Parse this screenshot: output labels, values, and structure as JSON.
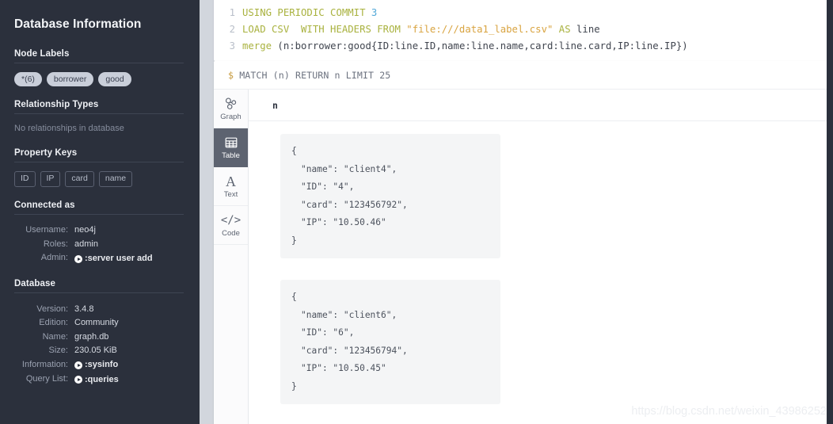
{
  "sidebar": {
    "title": "Database Information",
    "sections": {
      "node_labels": {
        "heading": "Node Labels",
        "pills": [
          "*(6)",
          "borrower",
          "good"
        ]
      },
      "relationship_types": {
        "heading": "Relationship Types",
        "empty_text": "No relationships in database"
      },
      "property_keys": {
        "heading": "Property Keys",
        "chips": [
          "ID",
          "IP",
          "card",
          "name"
        ]
      },
      "connected_as": {
        "heading": "Connected as",
        "rows": [
          {
            "key": "Username:",
            "value": "neo4j",
            "command": false
          },
          {
            "key": "Roles:",
            "value": "admin",
            "command": false
          },
          {
            "key": "Admin:",
            "value": ":server user add",
            "command": true
          }
        ]
      },
      "database": {
        "heading": "Database",
        "rows": [
          {
            "key": "Version:",
            "value": "3.4.8",
            "command": false
          },
          {
            "key": "Edition:",
            "value": "Community",
            "command": false
          },
          {
            "key": "Name:",
            "value": "graph.db",
            "command": false
          },
          {
            "key": "Size:",
            "value": "230.05 KiB",
            "command": false
          },
          {
            "key": "Information:",
            "value": ":sysinfo",
            "command": true
          },
          {
            "key": "Query List:",
            "value": ":queries",
            "command": true
          }
        ]
      }
    }
  },
  "editor": {
    "lines": [
      {
        "number": "1",
        "tokens": [
          {
            "t": "USING PERIODIC COMMIT ",
            "c": "kw"
          },
          {
            "t": "3",
            "c": "num"
          }
        ]
      },
      {
        "number": "2",
        "tokens": [
          {
            "t": "LOAD CSV  WITH HEADERS FROM ",
            "c": "kw"
          },
          {
            "t": "\"file:///data1_label.csv\"",
            "c": "str"
          },
          {
            "t": " ",
            "c": "plain"
          },
          {
            "t": "AS",
            "c": "kw"
          },
          {
            "t": " line",
            "c": "plain"
          }
        ]
      },
      {
        "number": "3",
        "tokens": [
          {
            "t": "merge",
            "c": "kw"
          },
          {
            "t": " (n:borrower:good{ID:line.ID,name:line.name,card:line.card,IP:line.IP})",
            "c": "plain"
          }
        ]
      }
    ]
  },
  "result": {
    "prompt_symbol": "$",
    "command": "MATCH (n) RETURN n LIMIT 25",
    "view_tabs": [
      {
        "label": "Graph",
        "icon": "graph-icon",
        "active": false
      },
      {
        "label": "Table",
        "icon": "table-icon",
        "active": true
      },
      {
        "label": "Text",
        "icon": "text-icon",
        "active": false
      },
      {
        "label": "Code",
        "icon": "code-icon",
        "active": false
      }
    ],
    "column_header": "n",
    "rows": [
      {
        "lines": [
          "{",
          "\"name\": \"client4\",",
          "\"ID\": \"4\",",
          "\"card\": \"123456792\",",
          "\"IP\": \"10.50.46\"",
          "}"
        ]
      },
      {
        "lines": [
          "{",
          "\"name\": \"client6\",",
          "\"ID\": \"6\",",
          "\"card\": \"123456794\",",
          "\"IP\": \"10.50.45\"",
          "}"
        ]
      }
    ]
  },
  "watermark": "https://blog.csdn.net/weixin_43986252",
  "colors": {
    "sidebar_bg": "#2b303c",
    "main_bg": "#d2d6dd",
    "accent_keyword": "#a9b23f",
    "accent_string": "#d9a441",
    "accent_number": "#52a8d8",
    "tab_active_bg": "#5d6370"
  }
}
